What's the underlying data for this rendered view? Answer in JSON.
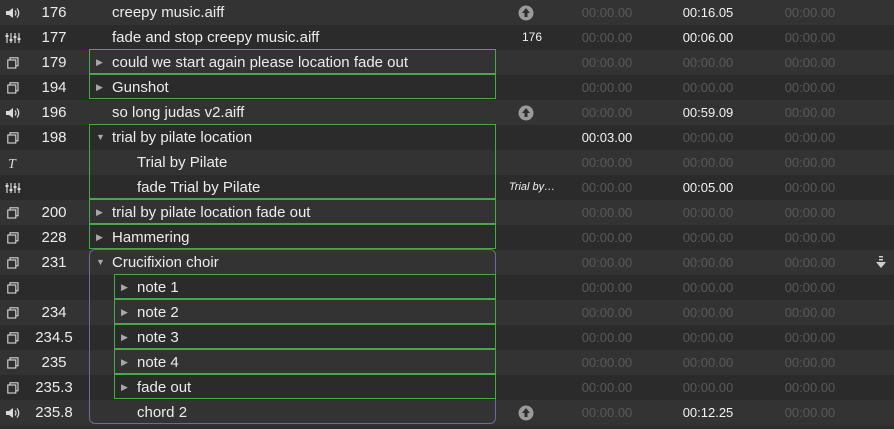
{
  "cues": [
    {
      "type": "audio",
      "number": "176",
      "name": "creepy music.aiff",
      "depth": 0,
      "tri": "",
      "target": "",
      "target_style": "",
      "status": "arrow",
      "pre_wait": "00:00.00",
      "action": "00:16.05",
      "post_wait": "00:00.00",
      "pre_bright": false,
      "action_bright": true,
      "post_bright": false
    },
    {
      "type": "fade",
      "number": "177",
      "name": "fade and stop creepy music.aiff",
      "depth": 0,
      "tri": "",
      "target": "176",
      "target_style": "",
      "status": "",
      "pre_wait": "00:00.00",
      "action": "00:06.00",
      "post_wait": "00:00.00",
      "pre_bright": false,
      "action_bright": true,
      "post_bright": false
    },
    {
      "type": "group",
      "number": "179",
      "name": "could we start again please location fade out",
      "depth": 0,
      "tri": "closed",
      "target": "",
      "target_style": "",
      "status": "",
      "pre_wait": "00:00.00",
      "action": "00:00.00",
      "post_wait": "00:00.00",
      "pre_bright": false,
      "action_bright": false,
      "post_bright": false
    },
    {
      "type": "group",
      "number": "194",
      "name": "Gunshot",
      "depth": 0,
      "tri": "closed",
      "target": "",
      "target_style": "",
      "status": "",
      "pre_wait": "00:00.00",
      "action": "00:00.00",
      "post_wait": "00:00.00",
      "pre_bright": false,
      "action_bright": false,
      "post_bright": false
    },
    {
      "type": "audio",
      "number": "196",
      "name": "so long judas v2.aiff",
      "depth": 0,
      "tri": "",
      "target": "",
      "target_style": "",
      "status": "arrow",
      "pre_wait": "00:00.00",
      "action": "00:59.09",
      "post_wait": "00:00.00",
      "pre_bright": false,
      "action_bright": true,
      "post_bright": false
    },
    {
      "type": "group",
      "number": "198",
      "name": "trial by pilate location",
      "depth": 0,
      "tri": "open",
      "target": "",
      "target_style": "",
      "status": "",
      "pre_wait": "00:03.00",
      "action": "00:00.00",
      "post_wait": "00:00.00",
      "pre_bright": true,
      "action_bright": false,
      "post_bright": false
    },
    {
      "type": "text",
      "number": "",
      "name": "Trial by Pilate",
      "depth": 1,
      "tri": "",
      "target": "",
      "target_style": "",
      "status": "",
      "pre_wait": "00:00.00",
      "action": "00:00.00",
      "post_wait": "00:00.00",
      "pre_bright": false,
      "action_bright": false,
      "post_bright": false
    },
    {
      "type": "fade",
      "number": "",
      "name": "fade Trial by Pilate",
      "depth": 1,
      "tri": "",
      "target": "Trial by…",
      "target_style": "italic",
      "status": "",
      "pre_wait": "00:00.00",
      "action": "00:05.00",
      "post_wait": "00:00.00",
      "pre_bright": false,
      "action_bright": true,
      "post_bright": false
    },
    {
      "type": "group",
      "number": "200",
      "name": "trial by pilate location fade out",
      "depth": 0,
      "tri": "closed",
      "target": "",
      "target_style": "",
      "status": "",
      "pre_wait": "00:00.00",
      "action": "00:00.00",
      "post_wait": "00:00.00",
      "pre_bright": false,
      "action_bright": false,
      "post_bright": false
    },
    {
      "type": "group",
      "number": "228",
      "name": "Hammering",
      "depth": 0,
      "tri": "closed",
      "target": "",
      "target_style": "",
      "status": "",
      "pre_wait": "00:00.00",
      "action": "00:00.00",
      "post_wait": "00:00.00",
      "pre_bright": false,
      "action_bright": false,
      "post_bright": false
    },
    {
      "type": "group",
      "number": "231",
      "name": "Crucifixion choir",
      "depth": 0,
      "tri": "open",
      "target": "",
      "target_style": "",
      "status": "",
      "pre_wait": "00:00.00",
      "action": "00:00.00",
      "post_wait": "00:00.00",
      "pre_bright": false,
      "action_bright": false,
      "post_bright": false
    },
    {
      "type": "group",
      "number": "",
      "name": "note 1",
      "depth": 1,
      "tri": "closed",
      "target": "",
      "target_style": "",
      "status": "",
      "pre_wait": "00:00.00",
      "action": "00:00.00",
      "post_wait": "00:00.00",
      "pre_bright": false,
      "action_bright": false,
      "post_bright": false
    },
    {
      "type": "group",
      "number": "234",
      "name": "note 2",
      "depth": 1,
      "tri": "closed",
      "target": "",
      "target_style": "",
      "status": "",
      "pre_wait": "00:00.00",
      "action": "00:00.00",
      "post_wait": "00:00.00",
      "pre_bright": false,
      "action_bright": false,
      "post_bright": false
    },
    {
      "type": "group",
      "number": "234.5",
      "name": "note 3",
      "depth": 1,
      "tri": "closed",
      "target": "",
      "target_style": "",
      "status": "",
      "pre_wait": "00:00.00",
      "action": "00:00.00",
      "post_wait": "00:00.00",
      "pre_bright": false,
      "action_bright": false,
      "post_bright": false
    },
    {
      "type": "group",
      "number": "235",
      "name": "note 4",
      "depth": 1,
      "tri": "closed",
      "target": "",
      "target_style": "",
      "status": "",
      "pre_wait": "00:00.00",
      "action": "00:00.00",
      "post_wait": "00:00.00",
      "pre_bright": false,
      "action_bright": false,
      "post_bright": false
    },
    {
      "type": "group",
      "number": "235.3",
      "name": "fade out",
      "depth": 1,
      "tri": "closed",
      "target": "",
      "target_style": "",
      "status": "",
      "pre_wait": "00:00.00",
      "action": "00:00.00",
      "post_wait": "00:00.00",
      "pre_bright": false,
      "action_bright": false,
      "post_bright": false
    },
    {
      "type": "audio",
      "number": "235.8",
      "name": "chord 2",
      "depth": 1,
      "tri": "",
      "target": "",
      "target_style": "",
      "status": "arrow",
      "pre_wait": "00:00.00",
      "action": "00:12.25",
      "post_wait": "00:00.00",
      "pre_bright": false,
      "action_bright": true,
      "post_bright": false
    }
  ],
  "playhead_icon": "playhead-down-arrow-icon",
  "colors": {
    "group_border": "#4aa84a",
    "nested_group_border": "#6e6a9a",
    "dim_time": "#595959",
    "bright_time": "#f2f2f2"
  }
}
